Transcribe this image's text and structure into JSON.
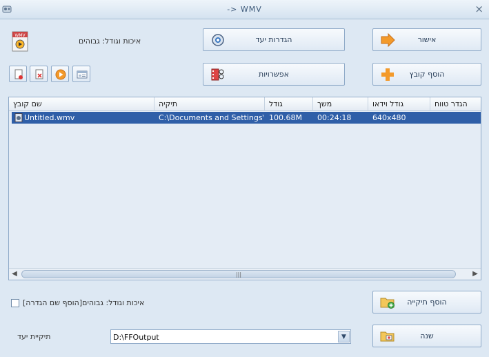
{
  "window": {
    "title": "-> WMV",
    "close_glyph": "×"
  },
  "buttons": {
    "ok": "אישור",
    "target_settings": "הגדרות יעד",
    "add_file": "הוסף קובץ",
    "options": "אפשרויות",
    "add_folder": "הוסף תיקייה",
    "change": "שנה"
  },
  "quality_label": "איכות וגודל: גבוהים",
  "format_badge": "WMV",
  "list": {
    "columns": [
      "שם קובץ",
      "תיקיה",
      "גודל",
      "משך",
      "גודל וידאו",
      "הגדר טווח"
    ],
    "rows": [
      {
        "name": "Untitled.wmv",
        "folder": "C:\\Documents and Settings\\...",
        "size": "100.68M",
        "duration": "00:24:18",
        "video_size": "640x480",
        "range": ""
      }
    ]
  },
  "checkbox_label": "[הוסף שם הגדרה]איכות וגודל: גבוהים",
  "dest": {
    "label": "תיקיית יעד",
    "value": "D:\\FFOutput"
  },
  "icons": {
    "ok": "arrow-right-icon",
    "target_settings": "gear-icon",
    "add_file": "plus-icon",
    "options": "film-scissors-icon",
    "add_folder": "folder-add-icon",
    "change": "folder-icon"
  }
}
